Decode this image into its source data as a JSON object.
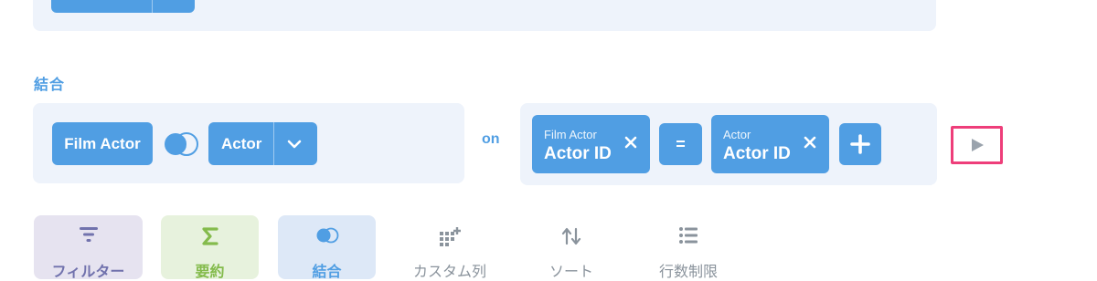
{
  "section": {
    "label": "結合"
  },
  "join": {
    "left_table": "Film Actor",
    "right_table": "Actor",
    "on_label": "on",
    "condition": {
      "left_table": "Film Actor",
      "left_column": "Actor ID",
      "operator": "=",
      "right_table": "Actor",
      "right_column": "Actor ID"
    }
  },
  "actions": {
    "filter": "フィルター",
    "summarize": "要約",
    "join": "結合",
    "custom_column": "カスタム列",
    "sort": "ソート",
    "row_limit": "行数制限"
  },
  "colors": {
    "accent": "#509ee3",
    "panel_bg": "#eef3fb",
    "highlight_border": "#ee3e7a",
    "filter_purple": "#7172ad",
    "summarize_green": "#84bb4c"
  }
}
